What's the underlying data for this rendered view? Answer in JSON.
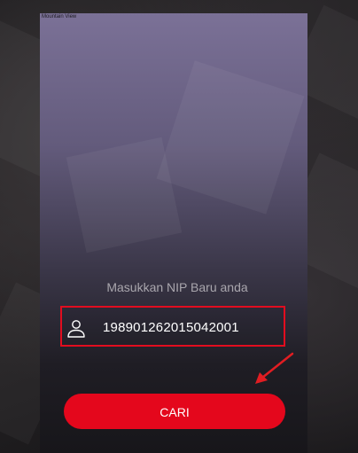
{
  "app": {
    "top_label": "Mountain View"
  },
  "form": {
    "prompt": "Masukkan NIP Baru anda",
    "nip_value": "198901262015042001",
    "field_icon": "user-icon",
    "submit_label": "CARI"
  },
  "colors": {
    "accent": "#e4071c",
    "field_border": "#e20d1f",
    "annotation": "#e11d22",
    "panel_top": "#7b7197",
    "panel_bottom": "#17161a"
  }
}
